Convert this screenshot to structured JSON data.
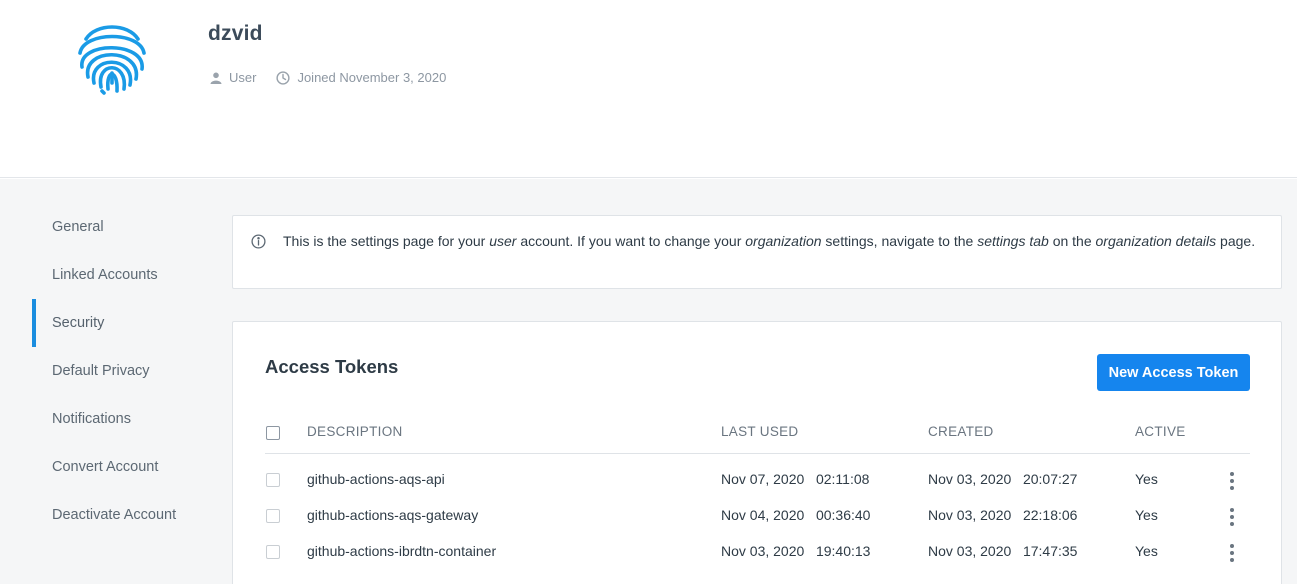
{
  "profile": {
    "username": "dzvid",
    "role": "User",
    "joined": "Joined November 3, 2020"
  },
  "sidebar": {
    "items": [
      {
        "label": "General"
      },
      {
        "label": "Linked Accounts"
      },
      {
        "label": "Security",
        "active": true
      },
      {
        "label": "Default Privacy"
      },
      {
        "label": "Notifications"
      },
      {
        "label": "Convert Account"
      },
      {
        "label": "Deactivate Account"
      }
    ]
  },
  "info": {
    "p1": "This is the settings page for your ",
    "em1": "user",
    "p2": " account. If you want to change your ",
    "em2": "organization",
    "p3": " settings, navigate to the ",
    "em3": "settings tab",
    "p4": " on the ",
    "em4": "organization details",
    "p5": " page."
  },
  "tokens": {
    "title": "Access Tokens",
    "new_button": "New Access Token",
    "columns": {
      "description": "DESCRIPTION",
      "last_used": "LAST USED",
      "created": "CREATED",
      "active": "ACTIVE"
    },
    "rows": [
      {
        "description": "github-actions-aqs-api",
        "last_used": "Nov 07, 2020   02:11:08",
        "created": "Nov 03, 2020   20:07:27",
        "active": "Yes"
      },
      {
        "description": "github-actions-aqs-gateway",
        "last_used": "Nov 04, 2020   00:36:40",
        "created": "Nov 03, 2020   22:18:06",
        "active": "Yes"
      },
      {
        "description": "github-actions-ibrdtn-container",
        "last_used": "Nov 03, 2020   19:40:13",
        "created": "Nov 03, 2020   17:47:35",
        "active": "Yes"
      }
    ]
  },
  "colors": {
    "accent": "#1585ee",
    "logo": "#1a9be6",
    "active_indicator": "#1a8ddf"
  },
  "icons": [
    "fingerprint-icon",
    "user-icon",
    "clock-icon",
    "info-icon",
    "more-vertical-icon"
  ]
}
